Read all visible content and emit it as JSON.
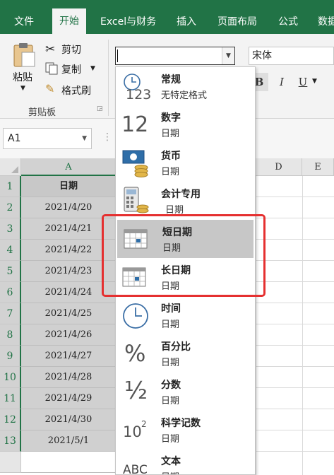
{
  "ribbon_tabs": [
    "文件",
    "开始",
    "Excel与财务",
    "插入",
    "页面布局",
    "公式",
    "数据"
  ],
  "clipboard": {
    "paste": "粘贴",
    "cut": "剪切",
    "copy": "复制",
    "format_painter": "格式刷",
    "group_label": "剪贴板"
  },
  "number_format": {
    "current_value": ""
  },
  "font": {
    "name": "宋体",
    "bold": "B",
    "italic": "I",
    "underline": "U"
  },
  "name_box": "A1",
  "columns": [
    "A",
    "D",
    "E"
  ],
  "rows": [
    "1",
    "2",
    "3",
    "4",
    "5",
    "6",
    "7",
    "8",
    "9",
    "10",
    "11",
    "12",
    "13"
  ],
  "column_a": [
    "日期",
    "2021/4/20",
    "2021/4/21",
    "2021/4/22",
    "2021/4/23",
    "2021/4/24",
    "2021/4/25",
    "2021/4/26",
    "2021/4/27",
    "2021/4/28",
    "2021/4/29",
    "2021/4/30",
    "2021/5/1"
  ],
  "format_menu": [
    {
      "name": "常规",
      "desc": "无特定格式",
      "icon": "clock-123-icon"
    },
    {
      "name": "数字",
      "desc": "日期",
      "icon": "number-12-icon",
      "big": "12"
    },
    {
      "name": "货币",
      "desc": "日期",
      "icon": "currency-icon"
    },
    {
      "name": "会计专用",
      "desc": "日期",
      "icon": "calculator-icon"
    },
    {
      "name": "短日期",
      "desc": "日期",
      "icon": "short-date-calendar-icon"
    },
    {
      "name": "长日期",
      "desc": "日期",
      "icon": "long-date-calendar-icon"
    },
    {
      "name": "时间",
      "desc": "日期",
      "icon": "clock-icon"
    },
    {
      "name": "百分比",
      "desc": "日期",
      "icon": "percent-icon",
      "big": "%"
    },
    {
      "name": "分数",
      "desc": "日期",
      "icon": "fraction-icon",
      "big": "½"
    },
    {
      "name": "科学记数",
      "desc": "日期",
      "icon": "scientific-icon",
      "big": "10",
      "sup": "2"
    },
    {
      "name": "文本",
      "desc": "日期",
      "icon": "text-abc-icon",
      "big": "ABC"
    }
  ],
  "icon_text": {
    "general_123": "123"
  },
  "highlight_color": "#e53030"
}
